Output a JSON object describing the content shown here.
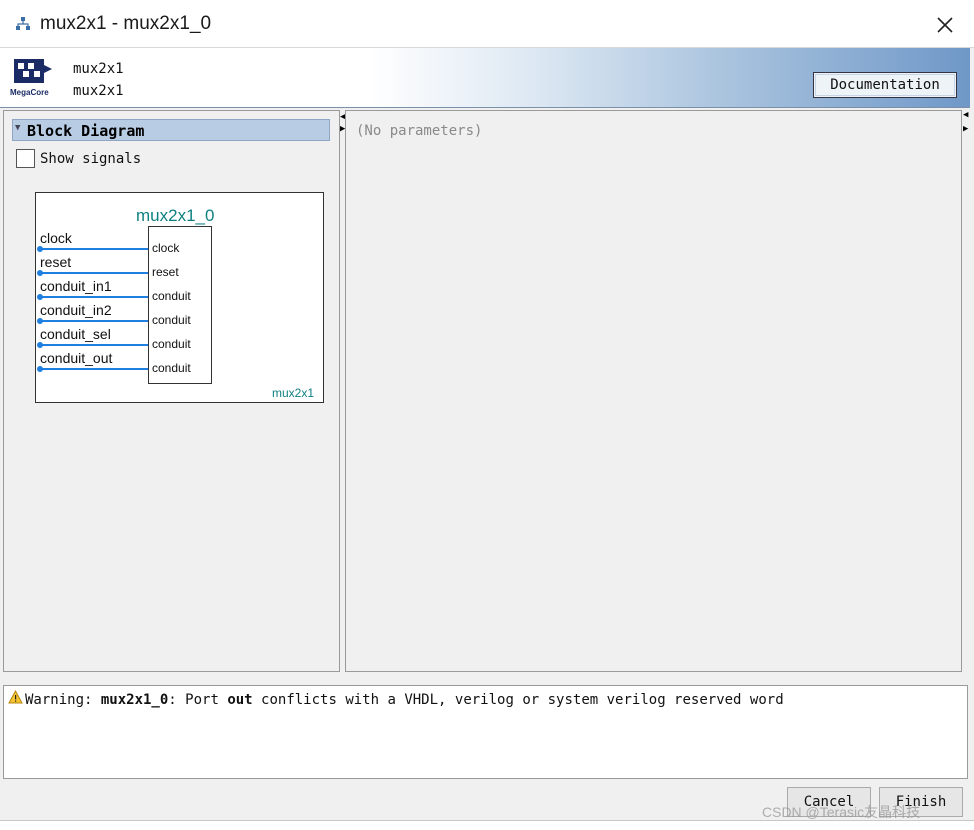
{
  "window": {
    "title": "mux2x1 - mux2x1_0",
    "icon": "tree-icon",
    "close_icon": "close-icon"
  },
  "header": {
    "logo": "megacore-logo",
    "logo_text": "MegaCore",
    "line1": "mux2x1",
    "line2": "mux2x1",
    "documentation_label": "Documentation"
  },
  "left_pane": {
    "section_title": "Block Diagram",
    "show_signals_label": "Show signals",
    "show_signals_checked": false,
    "diagram": {
      "instance_name": "mux2x1_0",
      "component_type": "mux2x1",
      "signals": [
        {
          "name": "clock",
          "port": "clock"
        },
        {
          "name": "reset",
          "port": "reset"
        },
        {
          "name": "conduit_in1",
          "port": "conduit"
        },
        {
          "name": "conduit_in2",
          "port": "conduit"
        },
        {
          "name": "conduit_sel",
          "port": "conduit"
        },
        {
          "name": "conduit_out",
          "port": "conduit"
        }
      ]
    }
  },
  "right_pane": {
    "placeholder": "(No parameters)"
  },
  "messages": {
    "warning": {
      "icon": "warning-icon",
      "prefix": "Warning: ",
      "instance": "mux2x1_0",
      "mid1": ": Port ",
      "port": "out",
      "rest": " conflicts with a VHDL, verilog or system verilog reserved word"
    }
  },
  "footer": {
    "cancel_label": "Cancel",
    "finish_label": "Finish",
    "watermark": "CSDN @Terasic友晶科技"
  },
  "colors": {
    "accent_blue": "#1f7fe0",
    "teal": "#0f8080",
    "section_header": "#b8cce4"
  }
}
